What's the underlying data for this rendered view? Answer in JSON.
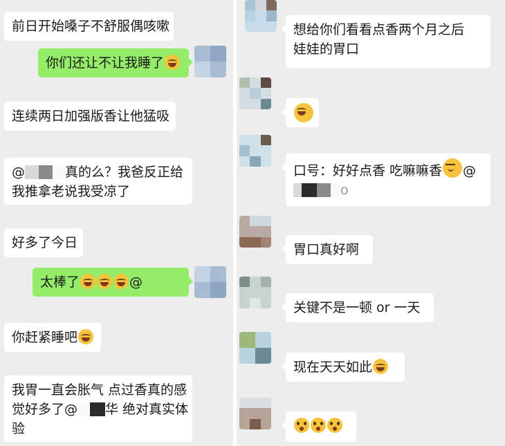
{
  "left": {
    "messages": [
      {
        "text": "前日开始嗓子不舒服偶咳嗽"
      },
      {
        "text": "你们还让不让我睡了"
      },
      {
        "text": "连续两日加强版香让他猛吸"
      },
      {
        "line1_pre": "@",
        "line1_post": "真的么？我爸反正给",
        "line2": "我推拿老说我受凉了"
      },
      {
        "text": "好多了今日"
      },
      {
        "text": "太棒了",
        "mention": "@"
      },
      {
        "text": "你赶紧睡吧"
      },
      {
        "line1": "我胃一直会胀气 点过香真的感",
        "line2_pre": "觉好多了@",
        "line2_post": "华 绝对真实体",
        "line3": "验"
      }
    ]
  },
  "right": {
    "messages": [
      {
        "line1": "想给你们看看点香两个月之后",
        "line2": "娃娃的胃口"
      },
      {
        "text": ""
      },
      {
        "line1": "口号：好好点香 吃嘛嘛香",
        "line1_mention": "@",
        "line2": "o"
      },
      {
        "text": "胃口真好啊"
      },
      {
        "text": "关键不是一顿 or 一天"
      },
      {
        "text": "现在天天如此"
      },
      {
        "text": ""
      }
    ]
  },
  "colors": {
    "background": "#ededed",
    "sent_bubble": "#95ec69",
    "received_bubble": "#ffffff"
  },
  "icons": [
    "laugh-cry-emoji",
    "shocked-emoji",
    "smirk-emoji",
    "avatar-mosaic"
  ]
}
